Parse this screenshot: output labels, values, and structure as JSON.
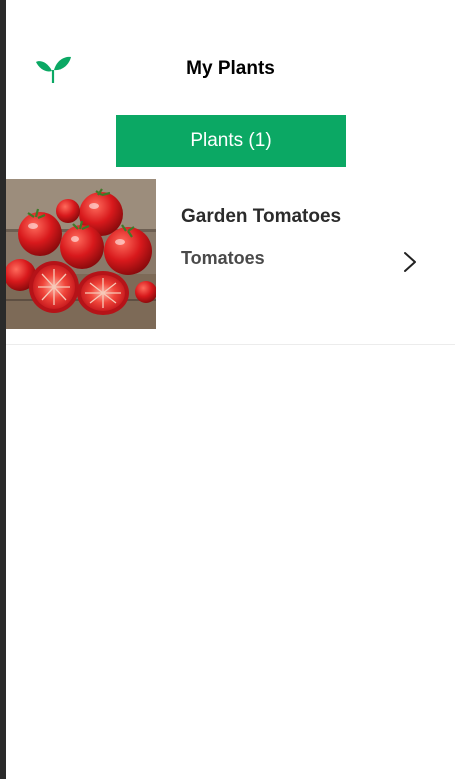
{
  "header": {
    "title": "My Plants",
    "logo_icon": "sprout-icon",
    "accent_color": "#0ba864"
  },
  "tabs": [
    {
      "label": "Plants (1)",
      "selected": true
    }
  ],
  "plants": [
    {
      "name": "Garden Tomatoes",
      "type": "Tomatoes",
      "thumbnail": "tomato-photo",
      "chevron_icon": "chevron-right-icon"
    }
  ]
}
